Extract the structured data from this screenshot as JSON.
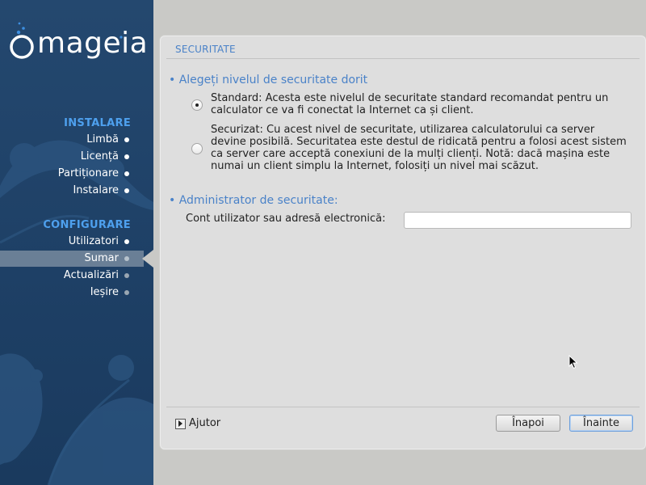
{
  "brand": {
    "logo_text": "mageia"
  },
  "sidebar": {
    "sections": [
      {
        "title": "INSTALARE"
      },
      {
        "title": "CONFIGURARE"
      }
    ],
    "install_steps": [
      {
        "label": "Limbă"
      },
      {
        "label": "Licență"
      },
      {
        "label": "Partiționare"
      },
      {
        "label": "Instalare"
      }
    ],
    "config_steps": [
      {
        "label": "Utilizatori"
      },
      {
        "label": "Sumar"
      },
      {
        "label": "Actualizări"
      },
      {
        "label": "Ieșire"
      }
    ],
    "active_step": "Sumar"
  },
  "page": {
    "step_title": "SECURITATE",
    "security_level": {
      "title": "• Alegeți nivelul de securitate dorit",
      "options": [
        {
          "text": "Standard: Acesta este nivelul de securitate standard recomandat pentru un calculator ce va fi conectat la Internet ca și client.",
          "selected": true
        },
        {
          "text": "Securizat: Cu acest nivel de securitate, utilizarea calculatorului ca server devine posibilă. Securitatea este destul de ridicată pentru a folosi acest sistem ca server care acceptă conexiuni de la mulți clienți. Notă: dacă mașina este numai un client simplu la Internet, folosiți un nivel mai scăzut.",
          "selected": false
        }
      ]
    },
    "admin": {
      "title": "• Administrator de securitate:",
      "field_label": "Cont utilizator sau adresă electronică:",
      "field_value": ""
    }
  },
  "footer": {
    "help_label": "Ajutor",
    "back_label": "Înapoi",
    "next_label": "Înainte"
  },
  "colors": {
    "sidebar_bg": "#1e4066",
    "section_title": "#4ea0ee",
    "accent_title": "#4a82c8",
    "panel_bg": "#dedede"
  }
}
